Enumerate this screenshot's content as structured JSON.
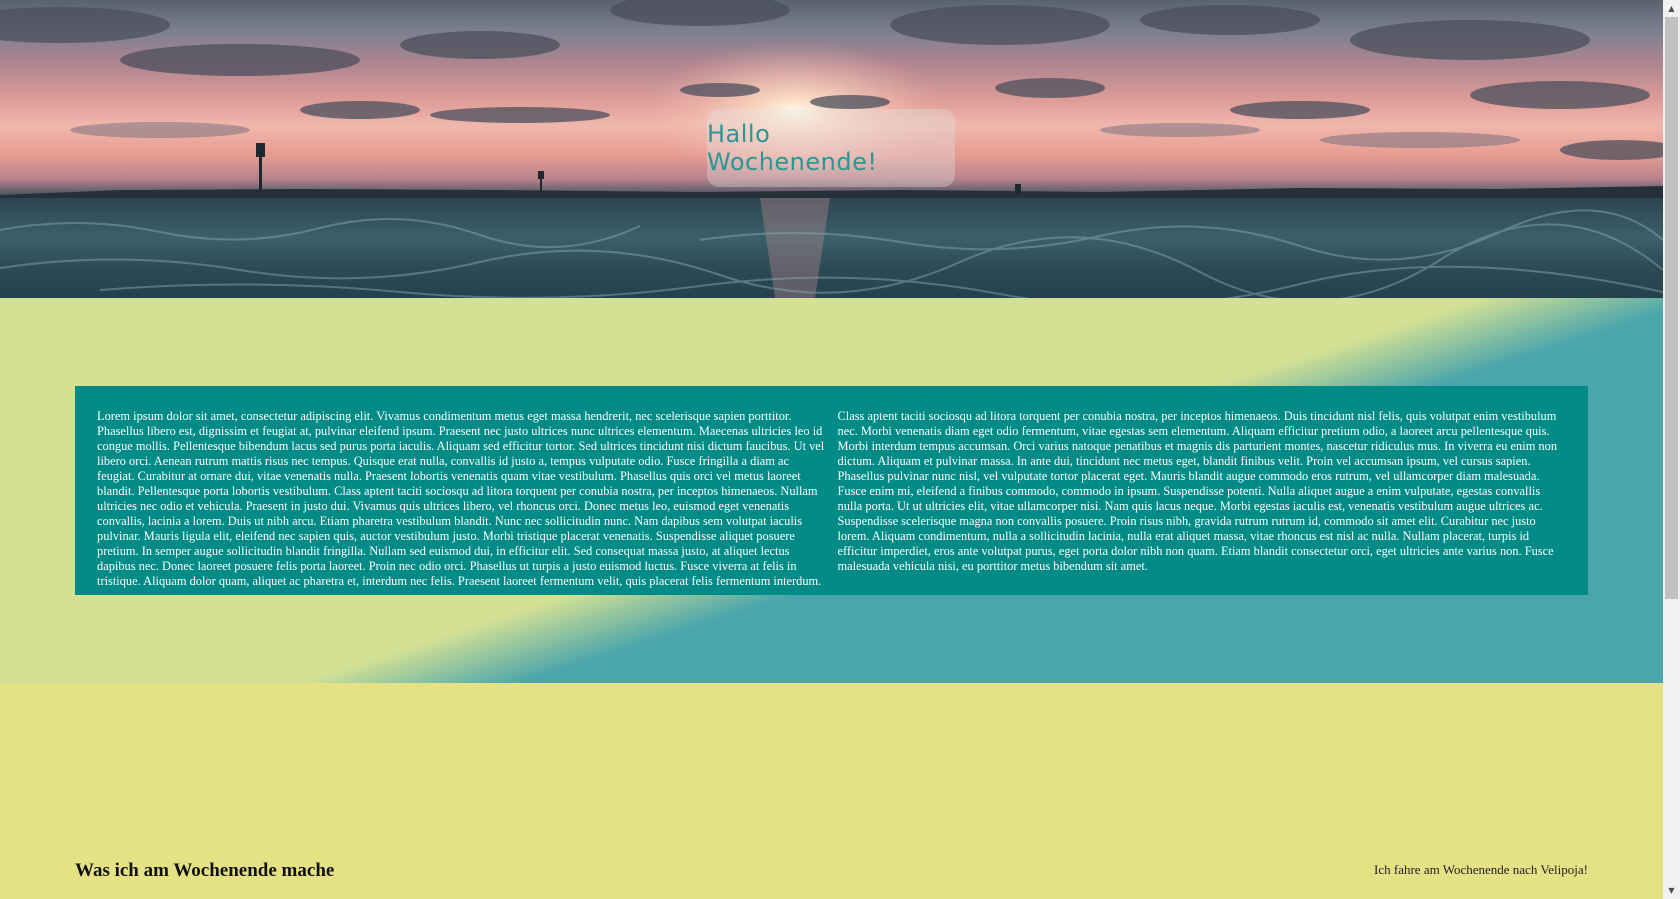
{
  "hero": {
    "title": "Hallo Wochenende!"
  },
  "intro": {
    "text": "Lorem ipsum dolor sit amet, consectetur adipiscing elit. Vivamus condimentum metus eget massa hendrerit, nec scelerisque sapien porttitor. Phasellus libero est, dignissim et feugiat at, pulvinar eleifend ipsum. Praesent nec justo ultrices nunc ultrices elementum. Maecenas ultricies leo id congue mollis. Pellentesque bibendum lacus sed purus porta iaculis. Aliquam sed efficitur tortor. Sed ultrices tincidunt nisi dictum faucibus. Ut vel libero orci. Aenean rutrum mattis risus nec tempus. Quisque erat nulla, convallis id justo a, tempus vulputate odio. Fusce fringilla a diam ac feugiat. Curabitur at ornare dui, vitae venenatis nulla. Praesent lobortis venenatis quam vitae vestibulum. Phasellus quis orci vel metus laoreet blandit. Pellentesque porta lobortis vestibulum. Class aptent taciti sociosqu ad litora torquent per conubia nostra, per inceptos himenaeos. Nullam ultricies nec odio et vehicula. Praesent in justo dui. Vivamus quis ultrices libero, vel rhoncus orci. Donec metus leo, euismod eget venenatis convallis, lacinia a lorem. Duis ut nibh arcu. Etiam pharetra vestibulum blandit. Nunc nec sollicitudin nunc. Nam dapibus sem volutpat iaculis pulvinar. Mauris ligula elit, eleifend nec sapien quis, auctor vestibulum justo. Morbi tristique placerat venenatis. Suspendisse aliquet posuere pretium. In semper augue sollicitudin blandit fringilla. Nullam sed euismod dui, in efficitur elit. Sed consequat massa justo, at aliquet lectus dapibus nec. Donec laoreet posuere felis porta laoreet. Proin nec odio orci. Phasellus ut turpis a justo euismod luctus. Fusce viverra at felis in tristique. Aliquam dolor quam, aliquet ac pharetra et, interdum nec felis. Praesent laoreet fermentum velit, quis placerat felis fermentum interdum. Class aptent taciti sociosqu ad litora torquent per conubia nostra, per inceptos himenaeos. Duis tincidunt nisl felis, quis volutpat enim vestibulum nec. Morbi venenatis diam eget odio fermentum, vitae egestas sem elementum. Aliquam efficitur pretium odio, a laoreet arcu pellentesque quis. Morbi interdum tempus accumsan. Orci varius natoque penatibus et magnis dis parturient montes, nascetur ridiculus mus. In viverra eu enim non dictum. Aliquam et pulvinar massa. In ante dui, tincidunt nec metus eget, blandit finibus velit. Proin vel accumsan ipsum, vel cursus sapien. Phasellus pulvinar nunc nisl, vel vulputate tortor placerat eget. Mauris blandit augue commodo eros rutrum, vel ullamcorper diam malesuada. Fusce enim mi, eleifend a finibus commodo, commodo in ipsum. Suspendisse potenti. Nulla aliquet augue a enim vulputate, egestas convallis nulla porta. Ut ut ultricies elit, vitae ullamcorper nisi. Nam quis lacus neque. Morbi egestas iaculis est, venenatis vestibulum augue ultrices ac. Suspendisse scelerisque magna non convallis posuere. Proin risus nibh, gravida rutrum rutrum id, commodo sit amet elit. Curabitur nec justo lorem. Aliquam condimentum, nulla a sollicitudin lacinia, nulla erat aliquet massa, vitae rhoncus est nisl ac nulla. Nullam placerat, turpis id efficitur imperdiet, eros ante volutpat purus, eget porta dolor nibh non quam. Etiam blandit consectetur orci, eget ultricies ante varius non. Fusce malesuada vehicula nisi, eu porttitor metus bibendum sit amet."
  },
  "bottom": {
    "heading": "Was ich am Wochenende mache",
    "note": "Ich fahre am Wochenende nach Velipoja!"
  },
  "colors": {
    "card_background": "#008b87",
    "title_color": "#2a9696",
    "section_yellow": "#e5e286",
    "section_green": "#d4e194",
    "section_teal": "#4aa5ac"
  },
  "icons": {
    "scroll_up": "▲",
    "scroll_down": "▼"
  }
}
